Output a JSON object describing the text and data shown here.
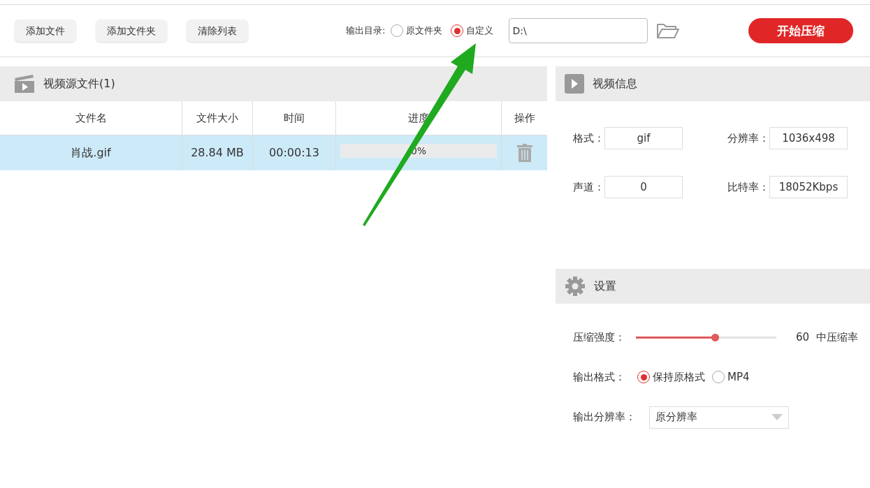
{
  "toolbar": {
    "buttons": [
      "添加文件",
      "添加文件夹",
      "清除列表"
    ],
    "output_dir_label": "输出目录:",
    "output_options": [
      {
        "label": "原文件夹",
        "selected": false
      },
      {
        "label": "自定义",
        "selected": true
      }
    ],
    "path": "D:\\",
    "start_button": "开始压缩"
  },
  "source_panel": {
    "title": "视频源文件(1)",
    "columns": [
      "文件名",
      "文件大小",
      "时间",
      "进度",
      "操作"
    ],
    "rows": [
      {
        "name": "肖战.gif",
        "size": "28.84 MB",
        "time": "00:00:13",
        "progress": {
          "level": 0,
          "reading": "0%"
        },
        "selected": true
      }
    ]
  },
  "info_panel": {
    "title": "视频信息",
    "fields": [
      {
        "label": "格式：",
        "value": "gif"
      },
      {
        "label": "分辨率：",
        "value": "1036x498"
      },
      {
        "label": "声道：",
        "value": "0"
      },
      {
        "label": "比特率：",
        "value": "18052Kbps"
      }
    ]
  },
  "settings_panel": {
    "title": "设置",
    "strength": {
      "label": "压缩强度：",
      "level": 0.56,
      "value": "60",
      "description": "中压缩率"
    },
    "format": {
      "label": "输出格式：",
      "options": [
        {
          "label": "保持原格式",
          "selected": true
        },
        {
          "label": "MP4",
          "selected": false
        }
      ]
    },
    "resolution": {
      "label": "输出分辨率：",
      "value": "原分辨率"
    }
  }
}
